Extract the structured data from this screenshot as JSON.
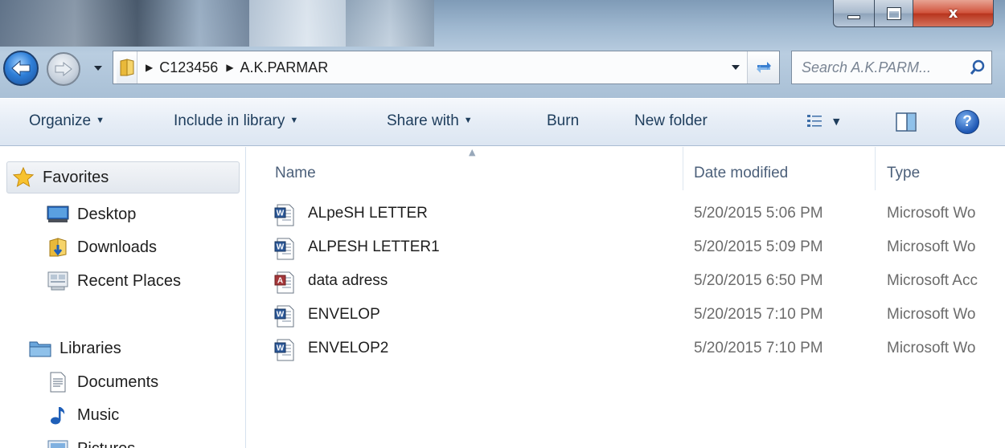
{
  "window": {
    "controls": {
      "minimize": "minimize",
      "maximize": "maximize",
      "close": "x"
    }
  },
  "addressbar": {
    "breadcrumbs": [
      "C123456",
      "A.K.PARMAR"
    ]
  },
  "search": {
    "placeholder": "Search A.K.PARM..."
  },
  "toolbar": {
    "organize": "Organize",
    "include_in_library": "Include in library",
    "share_with": "Share with",
    "burn": "Burn",
    "new_folder": "New folder",
    "help": "?"
  },
  "navpane": {
    "favorites": "Favorites",
    "favorite_items": [
      "Desktop",
      "Downloads",
      "Recent Places"
    ],
    "libraries": "Libraries",
    "library_items": [
      "Documents",
      "Music",
      "Pictures"
    ]
  },
  "filelist": {
    "columns": {
      "name": "Name",
      "date": "Date modified",
      "type": "Type"
    },
    "rows": [
      {
        "name": "ALpeSH LETTER",
        "date": "5/20/2015 5:06 PM",
        "type": "Microsoft Wo",
        "icon": "word-doc-icon"
      },
      {
        "name": "ALPESH LETTER1",
        "date": "5/20/2015 5:09 PM",
        "type": "Microsoft Wo",
        "icon": "word-doc-icon"
      },
      {
        "name": "data adress",
        "date": "5/20/2015 6:50 PM",
        "type": "Microsoft Acc",
        "icon": "access-db-icon"
      },
      {
        "name": "ENVELOP",
        "date": "5/20/2015 7:10 PM",
        "type": "Microsoft Wo",
        "icon": "word-doc-icon"
      },
      {
        "name": "ENVELOP2",
        "date": "5/20/2015 7:10 PM",
        "type": "Microsoft Wo",
        "icon": "word-doc-icon"
      }
    ]
  },
  "colors": {
    "accent": "#1e3d5c",
    "header_text": "#4c607a",
    "secondary_text": "#6b6b6b",
    "word_blue": "#2b5797",
    "access_red": "#a4373a"
  }
}
